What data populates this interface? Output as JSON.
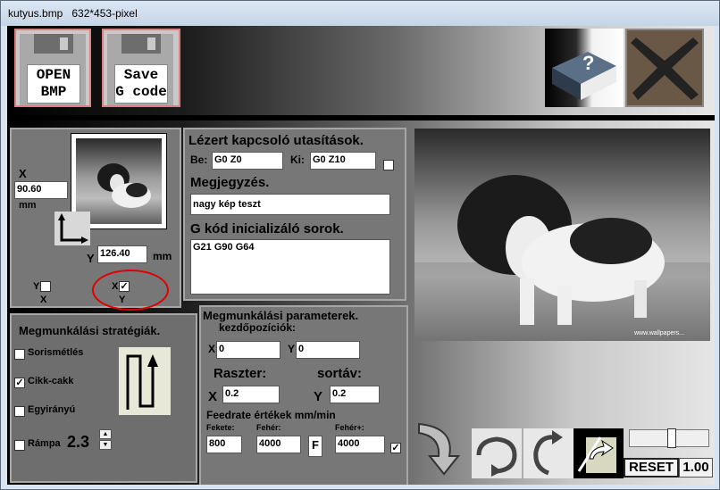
{
  "window": {
    "title": "kutyus.bmp   632*453-pixel"
  },
  "toolbar": {
    "open_label": "OPEN\nBMP",
    "save_label": "Save\nG code"
  },
  "position": {
    "x_label": "X",
    "x_value": "90.60",
    "x_unit": "mm",
    "y_label": "Y",
    "y_value": "126.40",
    "y_unit": "mm",
    "mirror_y_label": "Y",
    "mirror_y_sub": "X",
    "mirror_x_label": "X",
    "mirror_x_sub": "Y"
  },
  "laser": {
    "title": "Lézert kapcsoló utasítások.",
    "be_label": "Be:",
    "be_value": "G0 Z0",
    "ki_label": "Ki:",
    "ki_value": "G0 Z10",
    "note_title": "Megjegyzés.",
    "note_value": "nagy kép teszt",
    "init_title": "G kód inicializáló sorok.",
    "init_value": "G21 G90 G64"
  },
  "strategies": {
    "title": "Megmunkálási stratégiák.",
    "items": [
      {
        "label": "Sorismétlés",
        "checked": ""
      },
      {
        "label": "Cikk-cakk",
        "checked": "✓"
      },
      {
        "label": "Egyirányú",
        "checked": ""
      },
      {
        "label": "Rámpa",
        "checked": ""
      }
    ],
    "ramp_value": "2.3"
  },
  "params": {
    "title": "Megmunkálási parameterek.",
    "start_title": "kezdőpozíciók:",
    "x_label": "X",
    "x_value": "0",
    "y_label": "Y",
    "y_value": "0",
    "raster_label": "Raszter:",
    "row_label": "sortáv:",
    "rx_label": "X",
    "rx_value": "0.2",
    "ry_label": "Y",
    "ry_value": "0.2",
    "feed_title": "Feedrate értékek mm/min",
    "black_label": "Fekete:",
    "black_value": "800",
    "white_label": "Fehér:",
    "white_value": "4000",
    "f_label": "F",
    "whiteplus_label": "Fehér+:",
    "whiteplus_value": "4000",
    "whiteplus_checked": "✓"
  },
  "image": {
    "watermark": "www.wallpapers..."
  },
  "controls": {
    "reset_label": "RESET",
    "zoom_value": "1.00"
  }
}
